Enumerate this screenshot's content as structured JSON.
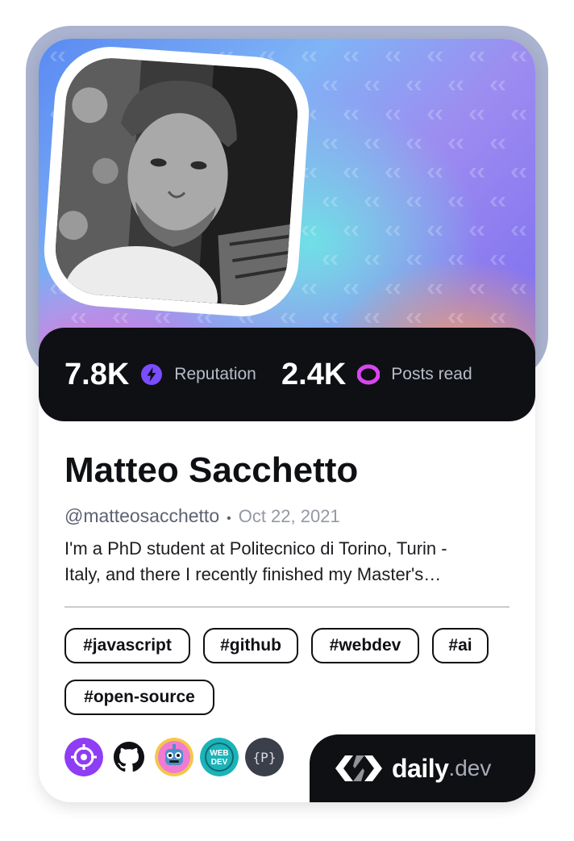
{
  "profile": {
    "name": "Matteo Sacchetto",
    "handle": "@matteosacchetto",
    "separator": "•",
    "joined": "Oct 22, 2021",
    "bio_line1": "I'm a PhD student at Politecnico di Torino, Turin -",
    "bio_line2": "Italy, and there I recently finished my Master's…"
  },
  "stats": {
    "reputation_value": "7.8K",
    "reputation_label": "Reputation",
    "reputation_icon": "lightning-icon",
    "posts_value": "2.4K",
    "posts_label": "Posts read",
    "posts_icon": "eye-ring-icon"
  },
  "tags": [
    "#javascript",
    "#github",
    "#webdev",
    "#ai",
    "#open-source"
  ],
  "sources": [
    {
      "icon": "crosshair-source-icon"
    },
    {
      "icon": "github-icon"
    },
    {
      "icon": "robot-source-icon"
    },
    {
      "icon": "webdev-source-icon"
    },
    {
      "icon": "p-braces-source-icon"
    }
  ],
  "source_labels": {
    "webdev_line1": "WEB",
    "webdev_line2": "DEV",
    "p_source": "{P}"
  },
  "brand": {
    "daily": "daily",
    "dev": ".dev",
    "icon": "daily-dev-logo-icon"
  },
  "colors": {
    "accent_purple": "#7b4dff",
    "accent_magenta": "#d946ef",
    "dark": "#0f1014",
    "frame": "#aab3cf"
  }
}
